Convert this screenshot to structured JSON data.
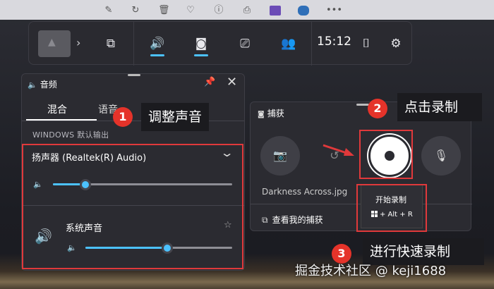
{
  "gamebar": {
    "time": "15:12"
  },
  "audio": {
    "title": "音频",
    "tabs": [
      {
        "label": "混合",
        "active": true
      },
      {
        "label": "语音",
        "active": false
      }
    ],
    "output_header": "WINDOWS 默认输出",
    "device_label": "扬声器 (Realtek(R) Audio)",
    "master_volume": 0.18,
    "app_label": "系统声音",
    "app_volume": 0.56
  },
  "capture": {
    "title": "捕获",
    "last_file": "Darkness Across.jpg",
    "view_captures": "查看我的捕获",
    "tooltip_title": "开始录制",
    "tooltip_shortcut": "+ Alt + R"
  },
  "annotations": [
    {
      "number": "1",
      "text": "调整声音"
    },
    {
      "number": "2",
      "text": "点击录制"
    },
    {
      "number": "3",
      "text": "进行快速录制"
    }
  ],
  "watermark": "掘金技术社区 @ keji1688",
  "colors": {
    "accent": "#4cc2ff",
    "highlight_red": "#e0393b",
    "panel_bg": "#2b2b31"
  },
  "icons": {
    "audio": "speaker-icon",
    "capture": "webcam-icon",
    "performance": "monitor-icon",
    "social": "people-icon",
    "settings": "gear-icon",
    "mouse": "mouse-icon"
  }
}
